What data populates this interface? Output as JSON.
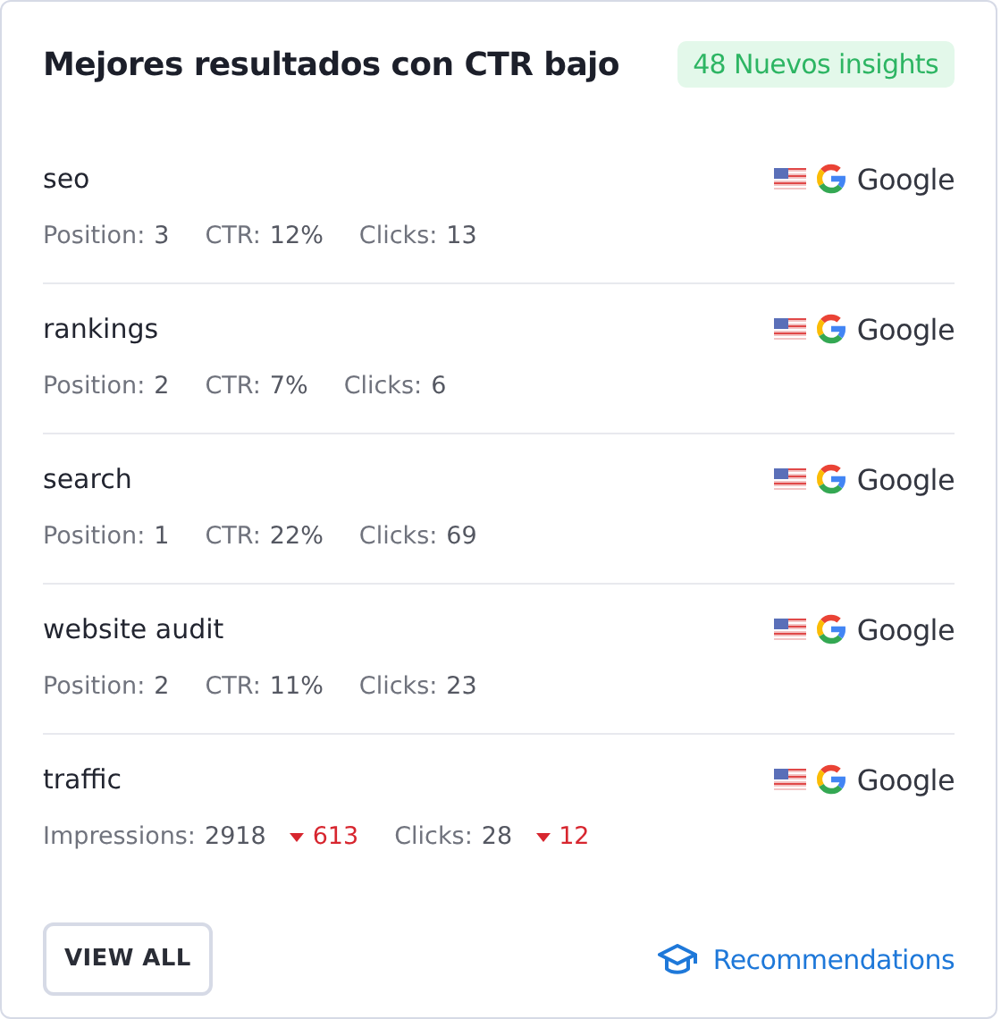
{
  "title": "Mejores resultados con CTR bajo",
  "badge": "48 Nuevos insights",
  "rows": [
    {
      "keyword": "seo",
      "engine": "Google",
      "stats": [
        {
          "label": "Position:",
          "value": "3"
        },
        {
          "label": "CTR:",
          "value": "12%"
        },
        {
          "label": "Clicks:",
          "value": "13"
        }
      ]
    },
    {
      "keyword": "rankings",
      "engine": "Google",
      "stats": [
        {
          "label": "Position:",
          "value": "2"
        },
        {
          "label": "CTR:",
          "value": "7%"
        },
        {
          "label": "Clicks:",
          "value": "6"
        }
      ]
    },
    {
      "keyword": "search",
      "engine": "Google",
      "stats": [
        {
          "label": "Position:",
          "value": "1"
        },
        {
          "label": "CTR:",
          "value": "22%"
        },
        {
          "label": "Clicks:",
          "value": "69"
        }
      ]
    },
    {
      "keyword": "website audit",
      "engine": "Google",
      "stats": [
        {
          "label": "Position:",
          "value": "2"
        },
        {
          "label": "CTR:",
          "value": "11%"
        },
        {
          "label": "Clicks:",
          "value": "23"
        }
      ]
    },
    {
      "keyword": "traffic",
      "engine": "Google",
      "stats": [
        {
          "label": "Impressions:",
          "value": "2918",
          "delta": "613",
          "falling": true
        },
        {
          "label": "Clicks:",
          "value": "28",
          "delta": "12",
          "falling": true
        }
      ]
    }
  ],
  "view_all": "VIEW ALL",
  "recommendations": "Recommendations"
}
